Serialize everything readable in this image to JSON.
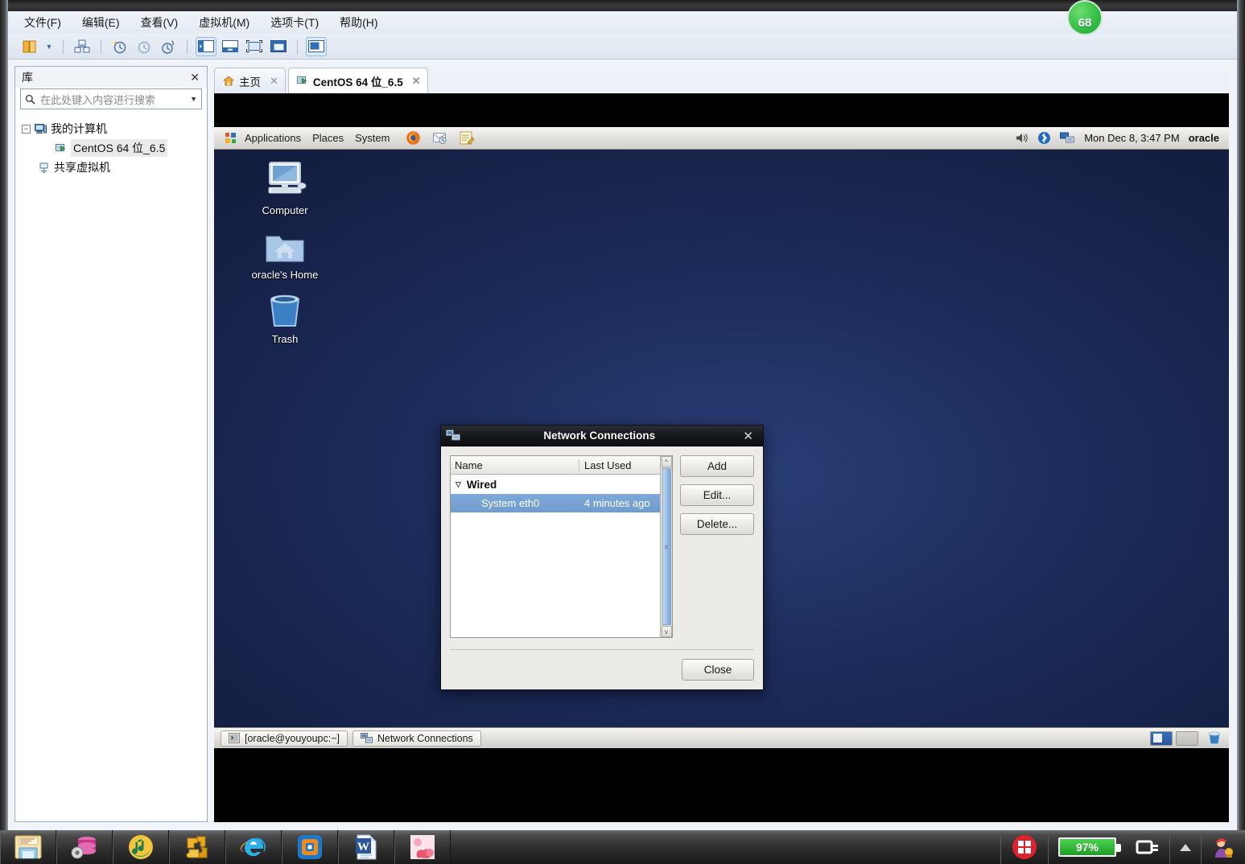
{
  "host_app": {
    "menu": [
      {
        "label": "文件(F)"
      },
      {
        "label": "编辑(E)"
      },
      {
        "label": "查看(V)"
      },
      {
        "label": "虚拟机(M)"
      },
      {
        "label": "选项卡(T)"
      },
      {
        "label": "帮助(H)"
      }
    ],
    "badge": "68",
    "library": {
      "title": "库",
      "close": "✕",
      "search_placeholder": "在此处键入内容进行搜索",
      "tree": [
        {
          "label": "我的计算机",
          "expander": "−",
          "icon": "computer-icon",
          "level": 0,
          "selected": false
        },
        {
          "label": "CentOS 64 位_6.5",
          "expander": "",
          "icon": "vm-running-icon",
          "level": 1,
          "selected": true
        },
        {
          "label": "共享虚拟机",
          "expander": "",
          "icon": "shared-vm-icon",
          "level": 0,
          "selected": false
        }
      ]
    },
    "tabs": [
      {
        "label": "主页",
        "icon": "home-icon",
        "close": "✕",
        "active": false
      },
      {
        "label": "CentOS 64 位_6.5",
        "icon": "vm-running-icon",
        "close": "✕",
        "active": true
      }
    ]
  },
  "guest": {
    "top_panel": {
      "menus": [
        "Applications",
        "Places",
        "System"
      ],
      "launchers": [
        "firefox-icon",
        "evolution-icon",
        "text-editor-icon"
      ],
      "tray": [
        "volume-icon",
        "bluetooth-icon",
        "network-icon"
      ],
      "clock": "Mon Dec  8,  3:47 PM",
      "user": "oracle"
    },
    "desktop_icons": [
      {
        "label": "Computer",
        "icon": "computer-desktop-icon"
      },
      {
        "label": "oracle's Home",
        "icon": "home-folder-icon"
      },
      {
        "label": "Trash",
        "icon": "trash-icon"
      }
    ],
    "bottom_panel": {
      "tasks": [
        {
          "label": "[oracle@youyoupc:~]",
          "icon": "terminal-icon"
        },
        {
          "label": "Network Connections",
          "icon": "network-connections-icon"
        }
      ],
      "workspaces": [
        {
          "active": true
        },
        {
          "active": false
        }
      ],
      "trash_icon": "trash-small-icon"
    }
  },
  "dialog": {
    "title": "Network Connections",
    "title_icon": "network-connections-icon",
    "close": "✕",
    "columns": [
      "Name",
      "Last Used"
    ],
    "groups": [
      {
        "label": "Wired",
        "expander": "▽",
        "rows": [
          {
            "name": "System eth0",
            "last_used": "4 minutes ago",
            "selected": true
          }
        ]
      }
    ],
    "buttons": [
      {
        "label": "Add",
        "name": "add-button"
      },
      {
        "label": "Edit...",
        "name": "edit-button"
      },
      {
        "label": "Delete...",
        "name": "delete-button"
      }
    ],
    "close_button": "Close",
    "scrollbar": {
      "up": "^",
      "down": "v",
      "grip": "≡"
    }
  },
  "windows_taskbar": {
    "pinned": [
      {
        "name": "file-explorer-icon"
      },
      {
        "name": "database-settings-icon"
      },
      {
        "name": "music-player-icon"
      },
      {
        "name": "puzzle-app-icon"
      },
      {
        "name": "internet-explorer-icon"
      },
      {
        "name": "vmware-icon"
      },
      {
        "name": "word-icon"
      },
      {
        "name": "photo-app-icon"
      }
    ],
    "tray": {
      "app_icon": "red-windows-icon",
      "battery_percent": "97%",
      "power_icon": "power-plug-icon",
      "overflow_icon": "show-hidden-icons-icon",
      "notify_icon": "notification-icon"
    }
  },
  "colors": {
    "desktop": "#1d2c5c",
    "selection": "#7fa8d8",
    "badge_green": "#35c04a",
    "battery_green": "#28a12b"
  }
}
